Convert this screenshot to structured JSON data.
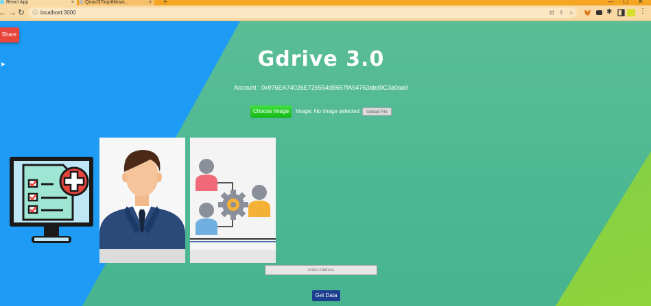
{
  "browser": {
    "tabs": [
      {
        "title": "React App",
        "active": true
      },
      {
        "title": "QmaJ37kqn8kksw...",
        "active": false
      }
    ],
    "url": "localhost:3000",
    "new_tab": "+",
    "tab_close": "×",
    "win_controls": [
      "—",
      "☐",
      "✕"
    ],
    "nav": {
      "back": "←",
      "forward": "→",
      "reload": "↻"
    }
  },
  "page": {
    "share_label": "Share",
    "title": "Gdrive 3.0",
    "account": "Account : 0x976EA74026E726554dB657fA54763abd0C3a0aa9",
    "choose_label": "Choose Image",
    "image_label": "Image: No image selected",
    "upload_label": "Upload File",
    "address_placeholder": "Enter Address",
    "get_data_label": "Get Data"
  },
  "images": [
    {
      "name": "medical-record-monitor-icon"
    },
    {
      "name": "businessman-portrait"
    },
    {
      "name": "team-workflow-icon"
    }
  ],
  "colors": {
    "background_blue": "#1e9bf5",
    "background_green": "#4db894",
    "share_red": "#e8453c",
    "choose_green": "#16b916",
    "get_data_navy": "#1d3f8f",
    "tab_orange": "#f5a623"
  }
}
